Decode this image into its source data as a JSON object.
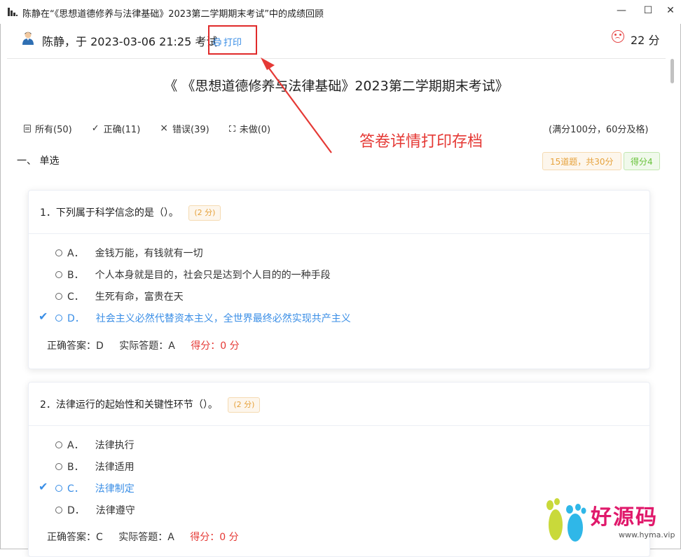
{
  "window": {
    "title": "陈静在“《思想道德修养与法律基础》2023第二学期期末考试”中的成绩回顾",
    "minimize_glyph": "—",
    "maximize_glyph": "☐",
    "close_glyph": "✕"
  },
  "header": {
    "user_info": "陈静，于 2023-03-06 21:25 考试",
    "print_label": "打印",
    "total_score": "22 分"
  },
  "exam": {
    "title": "《 《思想道德修养与法律基础》2023第二学期期末考试》",
    "full_score_note": "(满分100分，60分及格)"
  },
  "filters": [
    {
      "label": "所有(50)",
      "icon": "all-icon"
    },
    {
      "label": "正确(11)",
      "icon": "check-icon"
    },
    {
      "label": "错误(39)",
      "icon": "x-icon"
    },
    {
      "label": "未做(0)",
      "icon": "undone-icon"
    }
  ],
  "annotation": {
    "text": "答卷详情打印存档",
    "color": "#e53935"
  },
  "section": {
    "title": "一、 单选",
    "count_badge": "15道题，共30分",
    "score_badge": "得分4"
  },
  "questions": [
    {
      "text": "1．下列属于科学信念的是（）。",
      "points": "(2 分)",
      "options": [
        {
          "key": "A．",
          "text": "金钱万能，有钱就有一切"
        },
        {
          "key": "B．",
          "text": "个人本身就是目的，社会只是达到个人目的的一种手段"
        },
        {
          "key": "C．",
          "text": "生死有命，富贵在天"
        },
        {
          "key": "D．",
          "text": "社会主义必然代替资本主义，全世界最终必然实现共产主义"
        }
      ],
      "correct_answer": "正确答案：D",
      "actual_answer": "实际答题：A",
      "score": "得分：0 分"
    },
    {
      "text": "2．法律运行的起始性和关键性环节（）。",
      "points": "(2 分)",
      "options": [
        {
          "key": "A．",
          "text": "法律执行"
        },
        {
          "key": "B．",
          "text": "法律适用"
        },
        {
          "key": "C．",
          "text": "法律制定"
        },
        {
          "key": "D．",
          "text": "法律遵守"
        }
      ],
      "correct_answer": "正确答案：C",
      "actual_answer": "实际答题：A",
      "score": "得分：0 分"
    }
  ],
  "watermark": {
    "text": "好源码",
    "url": "www.hyma.vip"
  },
  "colors": {
    "accent": "#3a8ee6",
    "error": "#e53935",
    "warning": "#e6a23c",
    "success": "#67c23a"
  }
}
